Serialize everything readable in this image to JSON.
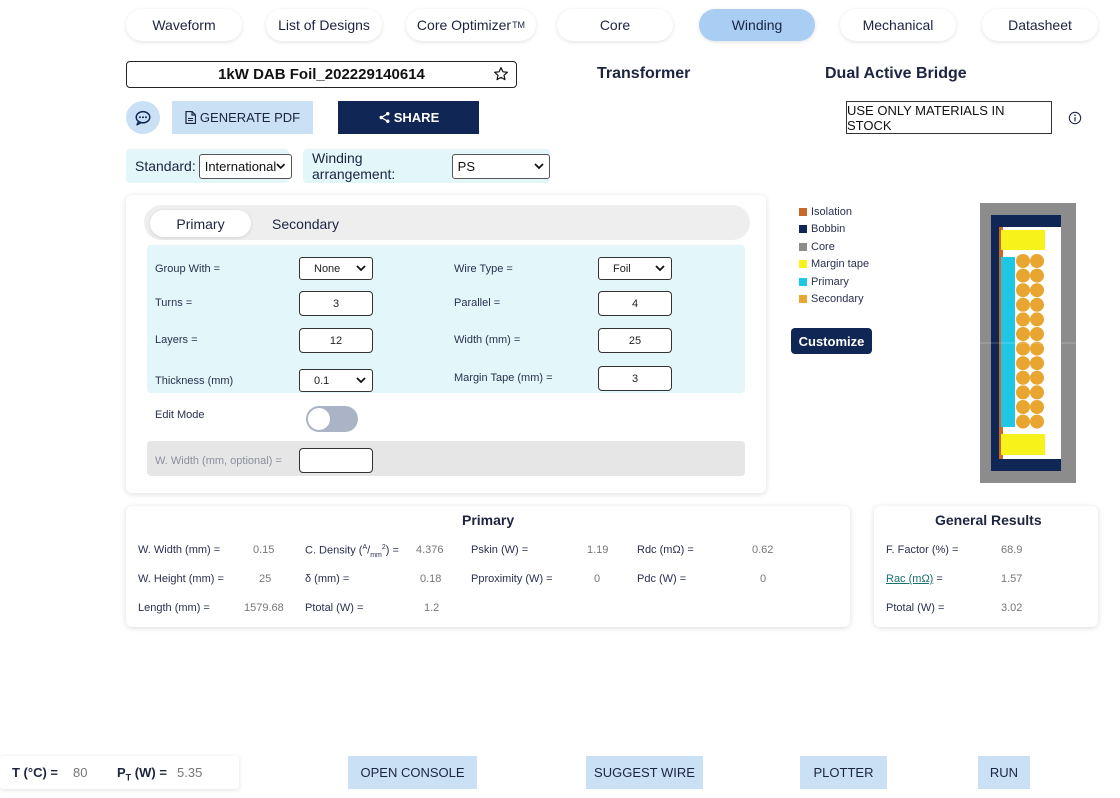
{
  "nav": {
    "tabs": [
      {
        "label": "Waveform"
      },
      {
        "label": "List of Designs"
      },
      {
        "label": "Core Optimizer",
        "sup": "TM"
      },
      {
        "label": "Core"
      },
      {
        "label": "Winding"
      },
      {
        "label": "Mechanical"
      },
      {
        "label": "Datasheet"
      }
    ],
    "active_tab": "Winding"
  },
  "design_name": "1kW DAB Foil_202229140614",
  "component_type": "Transformer",
  "topology": "Dual Active Bridge",
  "actions": {
    "generate_pdf": "GENERATE PDF",
    "share": "SHARE",
    "stock_only": "USE ONLY MATERIALS IN STOCK"
  },
  "standard": {
    "label": "Standard:",
    "value": "International"
  },
  "arrangement": {
    "label": "Winding arrangement:",
    "value": "PS"
  },
  "winding_tabs": {
    "primary": "Primary",
    "secondary": "Secondary",
    "active": "Primary"
  },
  "form": {
    "group_with": {
      "label": "Group With =",
      "value": "None"
    },
    "wire_type": {
      "label": "Wire Type =",
      "value": "Foil"
    },
    "turns": {
      "label": "Turns =",
      "value": "3"
    },
    "parallel": {
      "label": "Parallel =",
      "value": "4"
    },
    "layers": {
      "label": "Layers =",
      "value": "12"
    },
    "width": {
      "label": "Width (mm) =",
      "value": "25"
    },
    "thickness": {
      "label": "Thickness (mm)",
      "value": "0.1"
    },
    "margin_tape": {
      "label": "Margin Tape (mm) =",
      "value": "3"
    },
    "edit_mode": {
      "label": "Edit Mode",
      "on": false
    },
    "w_width": {
      "label": "W. Width (mm, optional) =",
      "value": ""
    }
  },
  "legend": {
    "items": [
      {
        "label": "Isolation",
        "color": "#c8692a"
      },
      {
        "label": "Bobbin",
        "color": "#102654"
      },
      {
        "label": "Core",
        "color": "#8c8c8c"
      },
      {
        "label": "Margin tape",
        "color": "#f7f21a"
      },
      {
        "label": "Primary",
        "color": "#1fc6e6"
      },
      {
        "label": "Secondary",
        "color": "#e8a530"
      }
    ],
    "customize": "Customize"
  },
  "primary_results": {
    "title": "Primary",
    "w_width": {
      "label": "W. Width (mm) =",
      "value": "0.15"
    },
    "c_density": {
      "label_pre": "C. Density (",
      "label_num": "A",
      "label_den": "mm",
      "label_exp": "2",
      "label_post": ") =",
      "value": "4.376"
    },
    "pskin": {
      "label": "Pskin (W) =",
      "value": "1.19"
    },
    "rdc": {
      "label": "Rdc (mΩ) =",
      "value": "0.62"
    },
    "w_height": {
      "label": "W. Height (mm) =",
      "value": "25"
    },
    "delta": {
      "label": "δ (mm) =",
      "value": "0.18"
    },
    "pproximity": {
      "label": "Pproximity (W) =",
      "value": "0"
    },
    "pdc": {
      "label": "Pdc (W) =",
      "value": "0"
    },
    "length": {
      "label": "Length (mm) =",
      "value": "1579.68"
    },
    "ptotal": {
      "label": "Ptotal (W) =",
      "value": "1.2"
    }
  },
  "general_results": {
    "title": "General Results",
    "f_factor": {
      "label": "F. Factor (%) =",
      "value": "68.9"
    },
    "rac": {
      "label_link": "Rac (mΩ)",
      "label_post": " =",
      "value": "1.57"
    },
    "ptotal": {
      "label": "Ptotal (W) =",
      "value": "3.02"
    }
  },
  "bottom": {
    "temp": {
      "label": "T (°C) =",
      "value": "80"
    },
    "power": {
      "label_pre": "P",
      "label_sub": "T",
      "label_post": " (W) =",
      "value": "5.35"
    },
    "open_console": "OPEN CONSOLE",
    "suggest_wire": "SUGGEST WIRE",
    "plotter": "PLOTTER",
    "run": "RUN"
  }
}
